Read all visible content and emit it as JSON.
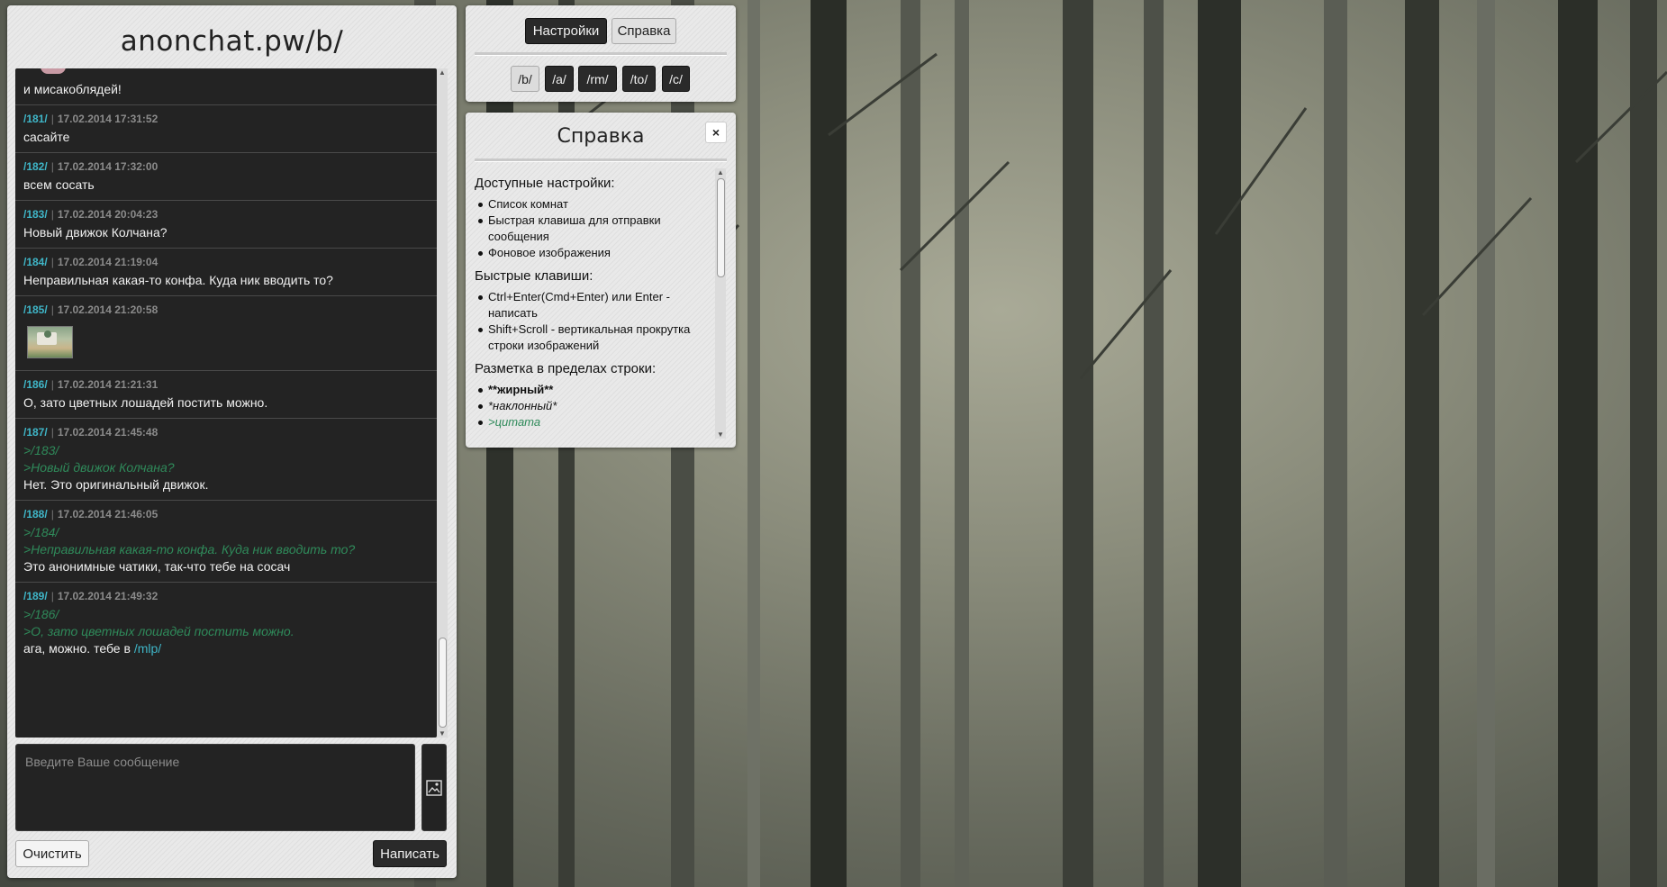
{
  "chat": {
    "title": "anonchat.pw/b/",
    "first_partial_text": "и мисакоблядей!",
    "messages": [
      {
        "id": "/181/",
        "time": "17.02.2014 17:31:52",
        "text": "сасайте"
      },
      {
        "id": "/182/",
        "time": "17.02.2014 17:32:00",
        "text": "всем сосать"
      },
      {
        "id": "/183/",
        "time": "17.02.2014 20:04:23",
        "text": "Новый движок Колчана?"
      },
      {
        "id": "/184/",
        "time": "17.02.2014 21:19:04",
        "text": "Неправильная какая-то конфа. Куда ник вводить то?"
      },
      {
        "id": "/185/",
        "time": "17.02.2014 21:20:58"
      },
      {
        "id": "/186/",
        "time": "17.02.2014 21:21:31",
        "text": "О, зато цветных лошадей постить можно."
      },
      {
        "id": "/187/",
        "time": "17.02.2014 21:45:48",
        "quote1": ">/183/",
        "quote2": ">Новый движок Колчана?",
        "text": "Нет. Это оригинальный движок."
      },
      {
        "id": "/188/",
        "time": "17.02.2014 21:46:05",
        "quote1": ">/184/",
        "quote2": ">Неправильная какая-то конфа. Куда ник вводить то?",
        "text": "Это анонимные чатики, так-что тебе на сосач"
      },
      {
        "id": "/189/",
        "time": "17.02.2014 21:49:32",
        "quote1": ">/186/",
        "quote2": ">О, зато цветных лошадей постить можно.",
        "text": "ага, можно. тебе в ",
        "link": "/mlp/"
      }
    ],
    "input_placeholder": "Введите Ваше сообщение",
    "clear_label": "Очистить",
    "send_label": "Написать"
  },
  "nav": {
    "settings_label": "Настройки",
    "help_label": "Справка",
    "rooms": [
      "/b/",
      "/a/",
      "/rm/",
      "/to/",
      "/c/"
    ]
  },
  "help": {
    "title": "Справка",
    "close": "×",
    "sections": [
      {
        "heading": "Доступные настройки:",
        "items": [
          "Список комнат",
          "Быстрая клавиша для отправки сообщения",
          "Фоновое изображения"
        ]
      },
      {
        "heading": "Быстрые клавиши:",
        "items": [
          "Ctrl+Enter(Cmd+Enter) или Enter - написать",
          "Shift+Scroll - вертикальная прокрутка строки изображений"
        ]
      },
      {
        "heading": "Разметка в пределах строки:",
        "items": [
          "**жирный**",
          "*наклонный*",
          ">цитата"
        ]
      }
    ]
  },
  "colors": {
    "accent": "#3fb6c8",
    "quote": "#2f8a5a",
    "dark": "#232323"
  }
}
